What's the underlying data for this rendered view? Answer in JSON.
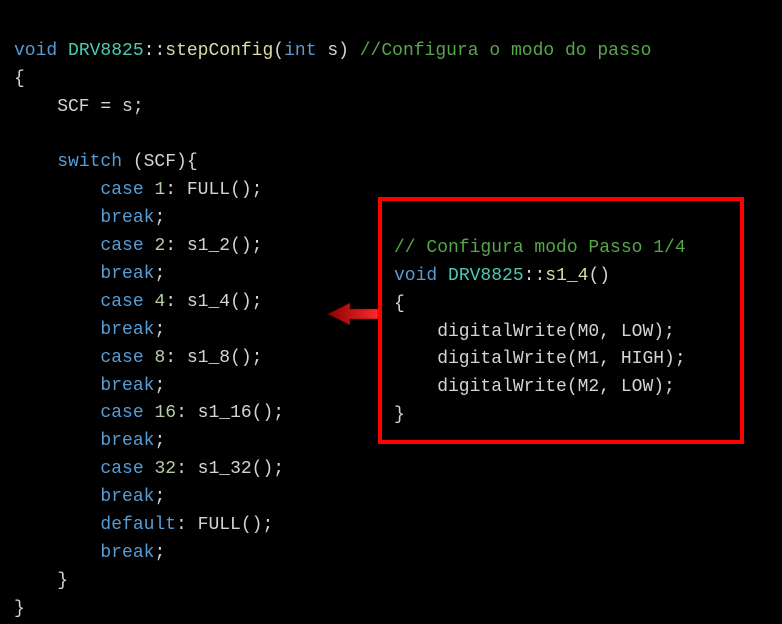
{
  "main": {
    "l1": {
      "a": "void",
      "b": "DRV8825",
      "c": "::",
      "d": "stepConfig",
      "e": "(",
      "f": "int",
      "g": " s) ",
      "h": "//Configura o modo do passo"
    },
    "l2": "{",
    "l3": "    SCF = s;",
    "l4": "",
    "l5": {
      "a": "    ",
      "b": "switch",
      "c": " (SCF){"
    },
    "c1": {
      "a": "        ",
      "b": "case",
      "c": " ",
      "d": "1",
      "e": ": FULL();"
    },
    "b1": {
      "a": "        ",
      "b": "break",
      "c": ";"
    },
    "c2": {
      "a": "        ",
      "b": "case",
      "c": " ",
      "d": "2",
      "e": ": s1_2();"
    },
    "b2": {
      "a": "        ",
      "b": "break",
      "c": ";"
    },
    "c4": {
      "a": "        ",
      "b": "case",
      "c": " ",
      "d": "4",
      "e": ": s1_4();"
    },
    "b4": {
      "a": "        ",
      "b": "break",
      "c": ";"
    },
    "c8": {
      "a": "        ",
      "b": "case",
      "c": " ",
      "d": "8",
      "e": ": s1_8();"
    },
    "b8": {
      "a": "        ",
      "b": "break",
      "c": ";"
    },
    "c16": {
      "a": "        ",
      "b": "case",
      "c": " ",
      "d": "16",
      "e": ": s1_16();"
    },
    "b16": {
      "a": "        ",
      "b": "break",
      "c": ";"
    },
    "c32": {
      "a": "        ",
      "b": "case",
      "c": " ",
      "d": "32",
      "e": ": s1_32();"
    },
    "b32": {
      "a": "        ",
      "b": "break",
      "c": ";"
    },
    "df": {
      "a": "        ",
      "b": "default",
      "c": ": FULL();"
    },
    "bdf": {
      "a": "        ",
      "b": "break",
      "c": ";"
    },
    "closeA": "    }",
    "closeB": "}"
  },
  "callout": {
    "l1": "// Configura modo Passo 1/4",
    "l2": {
      "a": "void",
      "b": " ",
      "c": "DRV8825",
      "d": "::",
      "e": "s1_4",
      "f": "()"
    },
    "l3": "{",
    "l4": "    digitalWrite(M0, LOW);",
    "l5": "    digitalWrite(M1, HIGH);",
    "l6": "    digitalWrite(M2, LOW);",
    "l7": "}"
  },
  "colors": {
    "keyword": "#569cd6",
    "type": "#4ec9b0",
    "func": "#dcdcaa",
    "num": "#b5cea8",
    "comment": "#57a64a",
    "calloutBorder": "#ff0000",
    "arrow": "#c00000"
  }
}
